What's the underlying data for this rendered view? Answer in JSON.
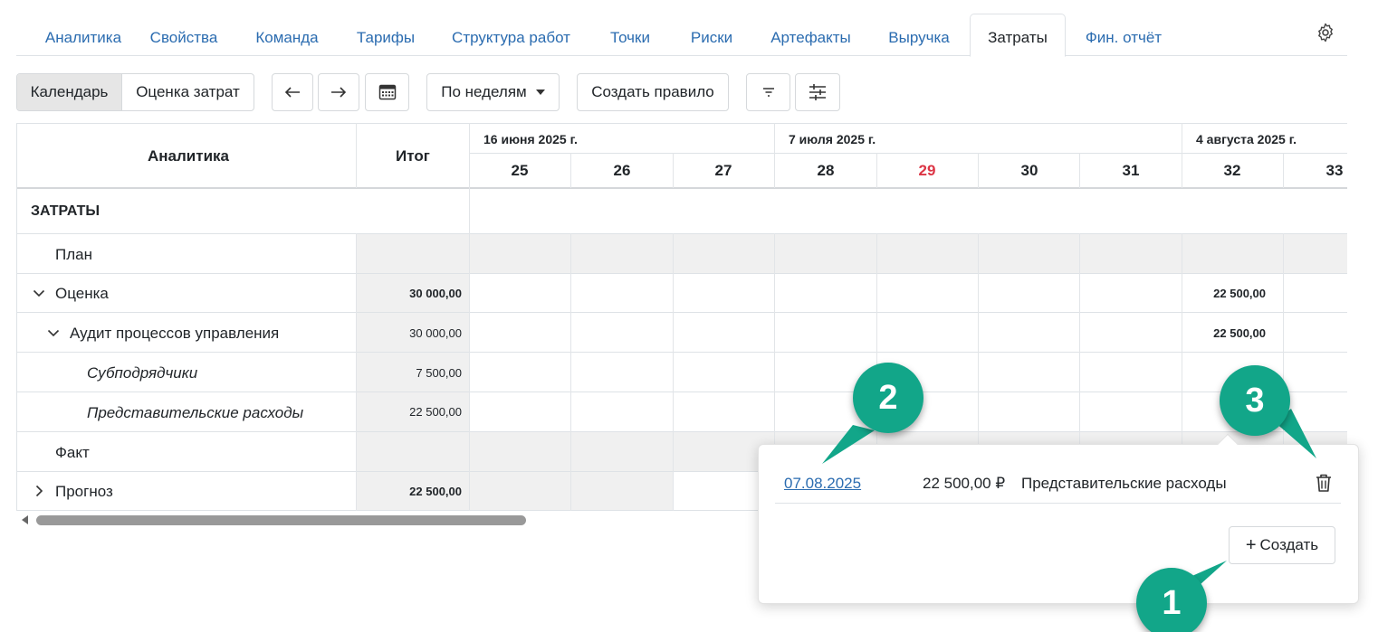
{
  "tabs": [
    {
      "label": "Аналитика"
    },
    {
      "label": "Свойства"
    },
    {
      "label": "Команда"
    },
    {
      "label": "Тарифы"
    },
    {
      "label": "Структура работ"
    },
    {
      "label": "Точки"
    },
    {
      "label": "Риски"
    },
    {
      "label": "Артефакты"
    },
    {
      "label": "Выручка"
    },
    {
      "label": "Затраты",
      "active": true
    },
    {
      "label": "Фин. отчёт"
    }
  ],
  "toolbar": {
    "view_calendar": "Календарь",
    "view_estimate": "Оценка затрат",
    "prev_icon": "arrow-left-icon",
    "next_icon": "arrow-right-icon",
    "calendar_icon": "calendar-icon",
    "period": "По неделям",
    "create_rule": "Создать правило",
    "filter_icon": "filter-icon",
    "settings_icon": "sliders-icon"
  },
  "table": {
    "headers": {
      "analytics": "Аналитика",
      "total": "Итог"
    },
    "months": [
      "16 июня 2025 г.",
      "7 июля 2025 г.",
      "4 августа 2025 г."
    ],
    "weeks": [
      {
        "num": "25",
        "highlight": false
      },
      {
        "num": "26",
        "highlight": false
      },
      {
        "num": "27",
        "highlight": false
      },
      {
        "num": "28",
        "highlight": false
      },
      {
        "num": "29",
        "highlight": true
      },
      {
        "num": "30",
        "highlight": false
      },
      {
        "num": "31",
        "highlight": false
      },
      {
        "num": "32",
        "highlight": false
      },
      {
        "num": "33",
        "highlight": false
      }
    ],
    "section": "ЗАТРАТЫ",
    "rows": [
      {
        "label": "План",
        "total": "",
        "w32": ""
      },
      {
        "label": "Оценка",
        "total": "30 000,00",
        "w32": "22 500,00"
      },
      {
        "label": "Аудит процессов управления",
        "total": "30 000,00",
        "w32": "22 500,00"
      },
      {
        "label": "Субподрядчики",
        "total": "7 500,00",
        "w32": ""
      },
      {
        "label": "Представительские расходы",
        "total": "22 500,00",
        "w32": ""
      },
      {
        "label": "Факт",
        "total": "",
        "w32": ""
      },
      {
        "label": "Прогноз",
        "total": "22 500,00",
        "w32": ""
      }
    ]
  },
  "popover": {
    "date": "07.08.2025",
    "amount": "22 500,00 ₽",
    "category": "Представительские расходы",
    "delete_icon": "trash-icon",
    "create_label": "Создать"
  },
  "callouts": {
    "one": "1",
    "two": "2",
    "three": "3"
  },
  "colors": {
    "accent": "#2b6cb0",
    "callout": "#12a689",
    "highlight_week": "#dc3545"
  }
}
